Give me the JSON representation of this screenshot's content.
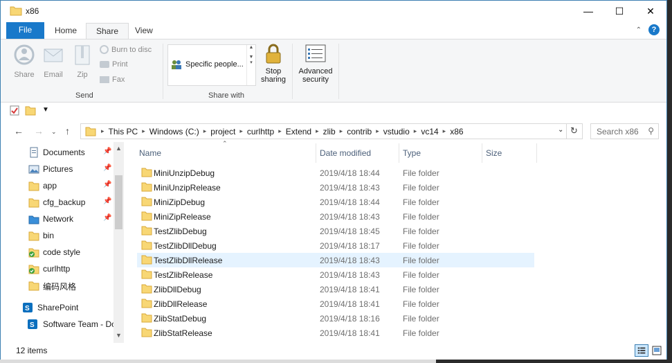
{
  "window": {
    "title": "x86"
  },
  "titlebar": {
    "minimize": "—",
    "maximize": "☐",
    "close": "✕"
  },
  "ribbon_tabs": [
    {
      "label": "File"
    },
    {
      "label": "Home"
    },
    {
      "label": "Share"
    },
    {
      "label": "View"
    }
  ],
  "ribbon": {
    "send": {
      "label": "Send",
      "share": "Share",
      "email": "Email",
      "zip": "Zip",
      "burn": "Burn to disc",
      "print": "Print",
      "fax": "Fax"
    },
    "share_with": {
      "label": "Share with",
      "specific_people": "Specific people...",
      "stop_sharing_line1": "Stop",
      "stop_sharing_line2": "sharing"
    },
    "advanced_security_line1": "Advanced",
    "advanced_security_line2": "security"
  },
  "address": {
    "crumbs": [
      "This PC",
      "Windows (C:)",
      "project",
      "curlhttp",
      "Extend",
      "zlib",
      "contrib",
      "vstudio",
      "vc14",
      "x86"
    ]
  },
  "search": {
    "placeholder": "Search x86"
  },
  "nav_pane": [
    {
      "label": "Documents",
      "icon": "documents-icon",
      "pinned": true
    },
    {
      "label": "Pictures",
      "icon": "pictures-icon",
      "pinned": true
    },
    {
      "label": "app",
      "icon": "folder-icon",
      "pinned": true
    },
    {
      "label": "cfg_backup",
      "icon": "folder-icon",
      "pinned": true
    },
    {
      "label": "Network",
      "icon": "network-icon",
      "pinned": true
    },
    {
      "label": "bin",
      "icon": "folder-icon",
      "pinned": false
    },
    {
      "label": "code style",
      "icon": "synced-folder-icon",
      "pinned": false
    },
    {
      "label": "curlhttp",
      "icon": "synced-folder-icon",
      "pinned": false
    },
    {
      "label": "编码风格",
      "icon": "folder-icon",
      "pinned": false
    },
    {
      "label": "SharePoint",
      "icon": "sharepoint-icon",
      "pinned": false
    },
    {
      "label": "Software Team - Dc",
      "icon": "sharepoint-icon",
      "pinned": false
    }
  ],
  "columns": {
    "name": "Name",
    "date": "Date modified",
    "type": "Type",
    "size": "Size"
  },
  "files": [
    {
      "name": "MiniUnzipDebug",
      "date": "2019/4/18 18:44",
      "type": "File folder"
    },
    {
      "name": "MiniUnzipRelease",
      "date": "2019/4/18 18:43",
      "type": "File folder"
    },
    {
      "name": "MiniZipDebug",
      "date": "2019/4/18 18:44",
      "type": "File folder"
    },
    {
      "name": "MiniZipRelease",
      "date": "2019/4/18 18:43",
      "type": "File folder"
    },
    {
      "name": "TestZlibDebug",
      "date": "2019/4/18 18:45",
      "type": "File folder"
    },
    {
      "name": "TestZlibDllDebug",
      "date": "2019/4/18 18:17",
      "type": "File folder"
    },
    {
      "name": "TestZlibDllRelease",
      "date": "2019/4/18 18:43",
      "type": "File folder",
      "selected": true
    },
    {
      "name": "TestZlibRelease",
      "date": "2019/4/18 18:43",
      "type": "File folder"
    },
    {
      "name": "ZlibDllDebug",
      "date": "2019/4/18 18:41",
      "type": "File folder"
    },
    {
      "name": "ZlibDllRelease",
      "date": "2019/4/18 18:41",
      "type": "File folder"
    },
    {
      "name": "ZlibStatDebug",
      "date": "2019/4/18 18:16",
      "type": "File folder"
    },
    {
      "name": "ZlibStatRelease",
      "date": "2019/4/18 18:41",
      "type": "File folder"
    }
  ],
  "status": {
    "count": "12 items"
  },
  "colors": {
    "accent": "#1979ca",
    "folder": "#f8d775",
    "selected_row": "#e5f3ff"
  }
}
